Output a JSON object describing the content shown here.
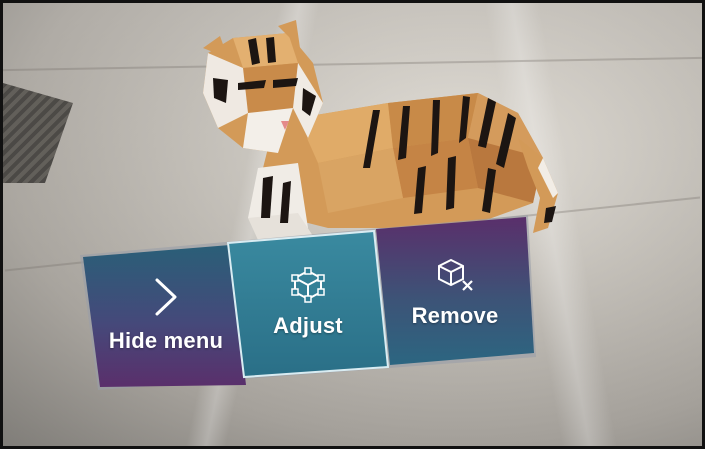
{
  "menu": {
    "hide_label": "Hide menu",
    "adjust_label": "Adjust",
    "remove_label": "Remove"
  },
  "icons": {
    "hide": "chevron-right-icon",
    "adjust": "adjust-cube-icon",
    "remove": "remove-cube-icon"
  },
  "colors": {
    "purple": "#5a2f6b",
    "teal": "#2f6f85",
    "selected_border": "#d9ecf2"
  }
}
